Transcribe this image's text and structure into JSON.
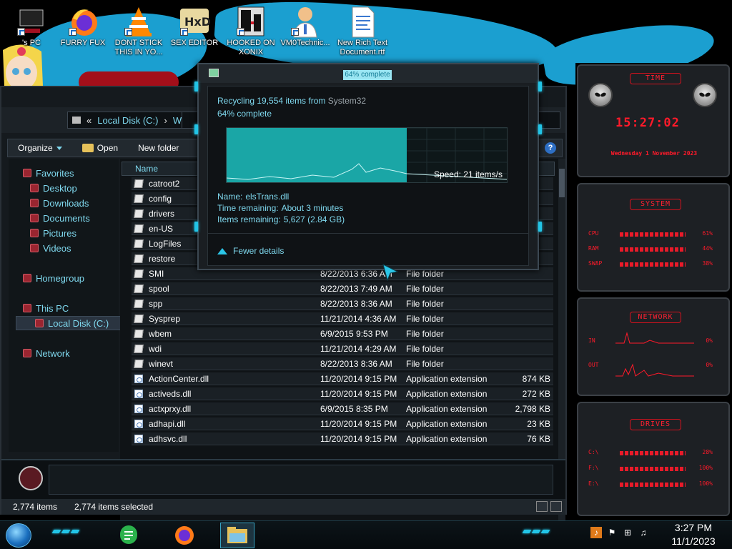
{
  "desktop_icons": [
    {
      "label": "'s PC",
      "icon": "computer-icon"
    },
    {
      "label": "FURRY FUX",
      "icon": "firefox-icon"
    },
    {
      "label": "DONT STICK THIS IN YO...",
      "icon": "vlc-icon"
    },
    {
      "label": "SEX EDITOR",
      "icon": "hxd-icon"
    },
    {
      "label": "HOOKED ON XONIX",
      "icon": "xonix-icon"
    },
    {
      "label": "VM0Technic...",
      "icon": "doctor-icon"
    },
    {
      "label": "New Rich Text Document.rtf",
      "icon": "document-icon"
    }
  ],
  "explorer": {
    "address": {
      "crumb_sep": "«",
      "location": "Local Disk (C:)",
      "sep": "›",
      "next": "W"
    },
    "toolbar": {
      "organize": "Organize",
      "open": "Open",
      "new_folder": "New folder",
      "help": "?"
    },
    "nav": [
      {
        "label": "Favorites",
        "icon": "star-icon"
      },
      {
        "label": "Desktop",
        "icon": "desktop-icon"
      },
      {
        "label": "Downloads",
        "icon": "downloads-icon"
      },
      {
        "label": "Documents",
        "icon": "documents-icon"
      },
      {
        "label": "Pictures",
        "icon": "pictures-icon"
      },
      {
        "label": "Videos",
        "icon": "videos-icon"
      },
      {
        "label": "Homegroup",
        "icon": "homegroup-icon"
      },
      {
        "label": "This PC",
        "icon": "computer-icon"
      },
      {
        "label": "Local Disk (C:)",
        "icon": "drive-icon"
      },
      {
        "label": "Network",
        "icon": "network-icon"
      }
    ],
    "columns": {
      "name": "Name"
    },
    "files": [
      {
        "name": "catroot2",
        "date": "",
        "type": "",
        "size": "",
        "kind": "folder"
      },
      {
        "name": "config",
        "date": "",
        "type": "",
        "size": "",
        "kind": "folder"
      },
      {
        "name": "drivers",
        "date": "",
        "type": "",
        "size": "",
        "kind": "folder"
      },
      {
        "name": "en-US",
        "date": "",
        "type": "",
        "size": "",
        "kind": "folder"
      },
      {
        "name": "LogFiles",
        "date": "",
        "type": "",
        "size": "",
        "kind": "folder"
      },
      {
        "name": "restore",
        "date": "",
        "type": "",
        "size": "",
        "kind": "folder"
      },
      {
        "name": "SMI",
        "date": "8/22/2013 6:36 AM",
        "type": "File folder",
        "size": "",
        "kind": "folder"
      },
      {
        "name": "spool",
        "date": "8/22/2013 7:49 AM",
        "type": "File folder",
        "size": "",
        "kind": "folder"
      },
      {
        "name": "spp",
        "date": "8/22/2013 8:36 AM",
        "type": "File folder",
        "size": "",
        "kind": "folder"
      },
      {
        "name": "Sysprep",
        "date": "11/21/2014 4:36 AM",
        "type": "File folder",
        "size": "",
        "kind": "folder"
      },
      {
        "name": "wbem",
        "date": "6/9/2015 9:53 PM",
        "type": "File folder",
        "size": "",
        "kind": "folder"
      },
      {
        "name": "wdi",
        "date": "11/21/2014 4:29 AM",
        "type": "File folder",
        "size": "",
        "kind": "folder"
      },
      {
        "name": "winevt",
        "date": "8/22/2013 8:36 AM",
        "type": "File folder",
        "size": "",
        "kind": "folder"
      },
      {
        "name": "ActionCenter.dll",
        "date": "11/20/2014 9:15 PM",
        "type": "Application extension",
        "size": "874 KB",
        "kind": "dll"
      },
      {
        "name": "activeds.dll",
        "date": "11/20/2014 9:15 PM",
        "type": "Application extension",
        "size": "272 KB",
        "kind": "dll"
      },
      {
        "name": "actxprxy.dll",
        "date": "6/9/2015 8:35 PM",
        "type": "Application extension",
        "size": "2,798 KB",
        "kind": "dll"
      },
      {
        "name": "adhapi.dll",
        "date": "11/20/2014 9:15 PM",
        "type": "Application extension",
        "size": "23 KB",
        "kind": "dll"
      },
      {
        "name": "adhsvc.dll",
        "date": "11/20/2014 9:15 PM",
        "type": "Application extension",
        "size": "76 KB",
        "kind": "dll"
      }
    ],
    "status": {
      "items": "2,774 items",
      "selected": "2,774 items selected"
    }
  },
  "dialog": {
    "title": "64% complete",
    "recycling_prefix": "Recycling 19,554 items from",
    "source": "System32",
    "percent_text": "64% complete",
    "progress": 0.64,
    "speed": "Speed: 21 items/s",
    "name_label": "Name:",
    "name_value": "elsTrans.dll",
    "time_label": "Time remaining:",
    "time_value": "About 3 minutes",
    "items_label": "Items remaining:",
    "items_value": "5,627 (2.84 GB)",
    "fewer_details": "Fewer details",
    "accent": "#1aa6a6"
  },
  "rainmeter": {
    "time_title": "TIME",
    "clock": "15:27:02",
    "date": "Wednesday 1 November 2023",
    "system_title": "SYSTEM",
    "system": [
      {
        "label": "CPU",
        "value": "61%"
      },
      {
        "label": "RAM",
        "value": "44%"
      },
      {
        "label": "SWAP",
        "value": "38%"
      }
    ],
    "network_title": "NETWORK",
    "network": [
      {
        "label": "IN",
        "value": "0%"
      },
      {
        "label": "OUT",
        "value": "0%"
      }
    ],
    "drives_title": "DRIVES",
    "drives": [
      {
        "label": "C:\\",
        "value": "28%"
      },
      {
        "label": "F:\\",
        "value": "100%"
      },
      {
        "label": "E:\\",
        "value": "100%"
      }
    ],
    "accent": "#ff1a2a"
  },
  "taskbar": {
    "apps": [
      "feedly-icon",
      "firefox-icon",
      "explorer-icon"
    ],
    "tray": [
      "sound-icon",
      "flag-icon",
      "network-icon",
      "volume-icon"
    ],
    "time": "3:27 PM",
    "date": "11/1/2023"
  }
}
